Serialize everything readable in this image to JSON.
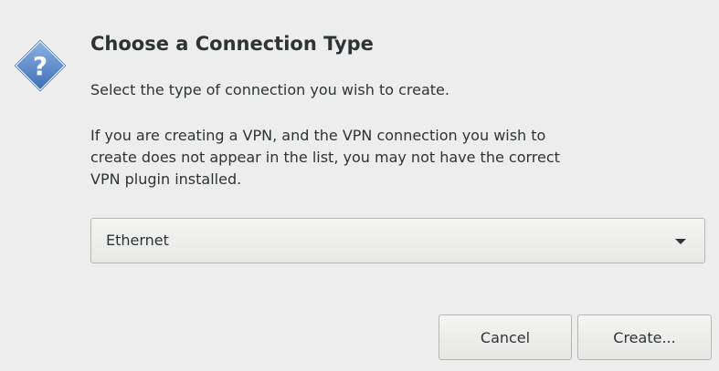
{
  "dialog": {
    "title": "Choose a Connection Type",
    "subtitle": "Select the type of connection you wish to create.",
    "notice": "If you are creating a VPN, and the VPN connection you wish to\ncreate does not appear in the list, you may not have the correct\nVPN plugin installed.",
    "icon": "question-icon",
    "accent_color": "#4a7fc1"
  },
  "connection_type": {
    "selected": "Ethernet",
    "icon": "chevron-down-icon"
  },
  "buttons": {
    "cancel_label": "Cancel",
    "create_label": "Create..."
  }
}
